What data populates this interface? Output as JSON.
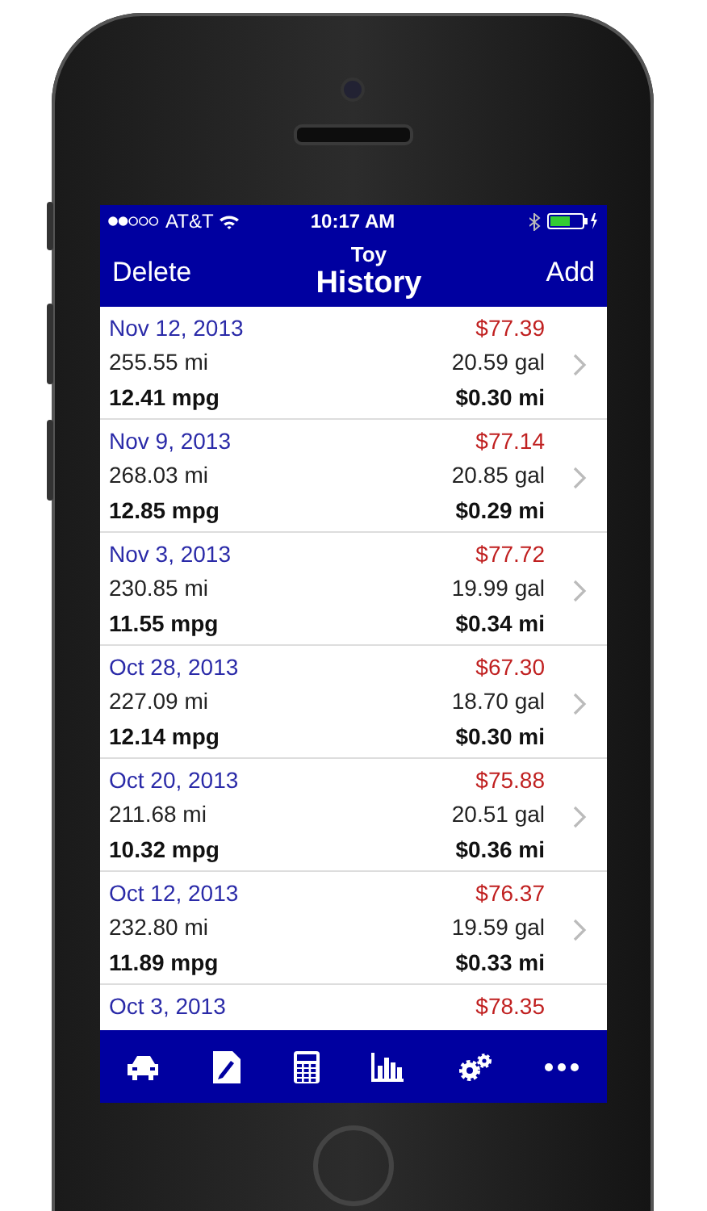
{
  "status_bar": {
    "carrier": "AT&T",
    "time": "10:17 AM"
  },
  "nav_bar": {
    "left_button": "Delete",
    "subtitle": "Toy",
    "title": "History",
    "right_button": "Add"
  },
  "entries": [
    {
      "date": "Nov 12, 2013",
      "cost": "$77.39",
      "distance": "255.55 mi",
      "volume": "20.59 gal",
      "economy": "12.41 mpg",
      "cost_per_distance": "$0.30 mi"
    },
    {
      "date": "Nov 9, 2013",
      "cost": "$77.14",
      "distance": "268.03 mi",
      "volume": "20.85 gal",
      "economy": "12.85 mpg",
      "cost_per_distance": "$0.29 mi"
    },
    {
      "date": "Nov 3, 2013",
      "cost": "$77.72",
      "distance": "230.85 mi",
      "volume": "19.99 gal",
      "economy": "11.55 mpg",
      "cost_per_distance": "$0.34 mi"
    },
    {
      "date": "Oct 28, 2013",
      "cost": "$67.30",
      "distance": "227.09 mi",
      "volume": "18.70 gal",
      "economy": "12.14 mpg",
      "cost_per_distance": "$0.30 mi"
    },
    {
      "date": "Oct 20, 2013",
      "cost": "$75.88",
      "distance": "211.68 mi",
      "volume": "20.51 gal",
      "economy": "10.32 mpg",
      "cost_per_distance": "$0.36 mi"
    },
    {
      "date": "Oct 12, 2013",
      "cost": "$76.37",
      "distance": "232.80 mi",
      "volume": "19.59 gal",
      "economy": "11.89 mpg",
      "cost_per_distance": "$0.33 mi"
    },
    {
      "date": "Oct 3, 2013",
      "cost": "$78.35"
    }
  ],
  "tab_bar": [
    {
      "kind": "car"
    },
    {
      "kind": "document"
    },
    {
      "kind": "calculator"
    },
    {
      "kind": "chart"
    },
    {
      "kind": "gears"
    },
    {
      "kind": "more"
    }
  ]
}
